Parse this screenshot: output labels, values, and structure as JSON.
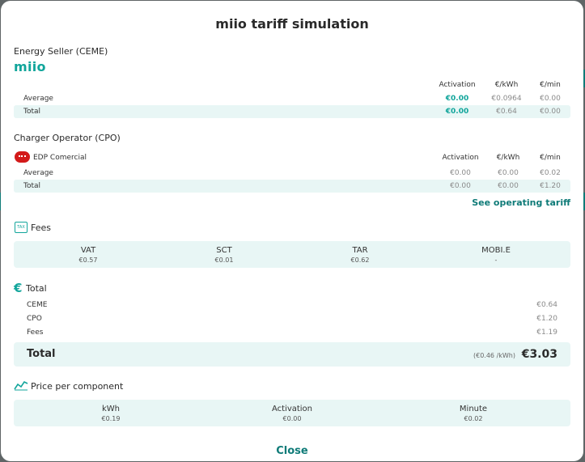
{
  "title": "miio tariff simulation",
  "ceme": {
    "section_label": "Energy Seller (CEME)",
    "brand": "miio",
    "columns": [
      "Activation",
      "€/kWh",
      "€/min"
    ],
    "rows": [
      {
        "label": "Average",
        "activation": "€0.00",
        "kwh": "€0.0964",
        "min": "€0.00"
      },
      {
        "label": "Total",
        "activation": "€0.00",
        "kwh": "€0.64",
        "min": "€0.00"
      }
    ]
  },
  "cpo": {
    "section_label": "Charger Operator (CPO)",
    "operator_name": "EDP Comercial",
    "columns": [
      "Activation",
      "€/kWh",
      "€/min"
    ],
    "rows": [
      {
        "label": "Average",
        "activation": "€0.00",
        "kwh": "€0.00",
        "min": "€0.02"
      },
      {
        "label": "Total",
        "activation": "€0.00",
        "kwh": "€0.00",
        "min": "€1.20"
      }
    ],
    "link": "See operating tariff"
  },
  "fees": {
    "section_label": "Fees",
    "icon": "tax-icon",
    "icon_text": "TAX",
    "items": [
      {
        "label": "VAT",
        "value": "€0.57"
      },
      {
        "label": "SCT",
        "value": "€0.01"
      },
      {
        "label": "TAR",
        "value": "€0.62"
      },
      {
        "label": "MOBI.E",
        "value": "-"
      }
    ]
  },
  "total": {
    "section_label": "Total",
    "icon": "euro-icon",
    "icon_glyph": "€",
    "lines": [
      {
        "label": "CEME",
        "value": "€0.64"
      },
      {
        "label": "CPO",
        "value": "€1.20"
      },
      {
        "label": "Fees",
        "value": "€1.19"
      }
    ],
    "grand_label": "Total",
    "per_kwh": "(€0.46 /kWh)",
    "grand_value": "€3.03"
  },
  "components": {
    "section_label": "Price per component",
    "icon": "chart-icon",
    "items": [
      {
        "label": "kWh",
        "value": "€0.19"
      },
      {
        "label": "Activation",
        "value": "€0.00"
      },
      {
        "label": "Minute",
        "value": "€0.02"
      }
    ]
  },
  "close_label": "Close",
  "colors": {
    "accent": "#11a59b",
    "accent_dark": "#0f7b78",
    "shade": "#e8f6f5",
    "cpo_logo": "#d31a1a"
  }
}
